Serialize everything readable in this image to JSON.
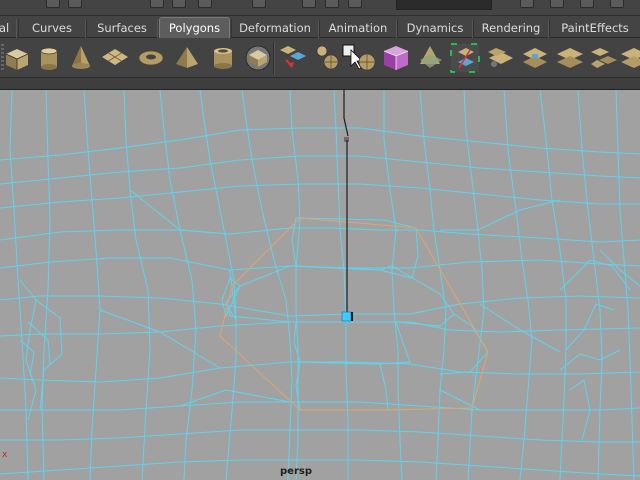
{
  "shelf_tabs": [
    {
      "label": "al",
      "active": false
    },
    {
      "label": "Curves",
      "active": false
    },
    {
      "label": "Surfaces",
      "active": false
    },
    {
      "label": "Polygons",
      "active": true
    },
    {
      "label": "Deformation",
      "active": false
    },
    {
      "label": "Animation",
      "active": false
    },
    {
      "label": "Dynamics",
      "active": false
    },
    {
      "label": "Rendering",
      "active": false
    },
    {
      "label": "PaintEffects",
      "active": false
    }
  ],
  "shelf_icons": [
    "poly-cube-icon",
    "poly-cylinder-icon",
    "poly-cone-icon",
    "poly-plane-icon",
    "poly-torus-icon",
    "poly-pyramid-icon",
    "poly-pipe-icon",
    "smooth-mesh-icon",
    "append-polygon-icon",
    "combine-icon",
    "separate-icon",
    "cursor-select-icon",
    "mirror-geometry-icon",
    "uv-cube-icon",
    "planar-mapping-icon",
    "split-polygon-icon",
    "extrude-face-icon",
    "bevel-icon",
    "merge-vertices-icon",
    "extrude-edge-icon",
    "poke-face-icon",
    "wedge-face-icon"
  ],
  "viewport": {
    "camera_label": "persp",
    "axis_label": "x"
  },
  "colors": {
    "wireframe": "#5fd4ee",
    "selection_outline": "#e0a56d",
    "pivot": "#3ccaff",
    "viewport_bg": "#a1a1a1"
  }
}
